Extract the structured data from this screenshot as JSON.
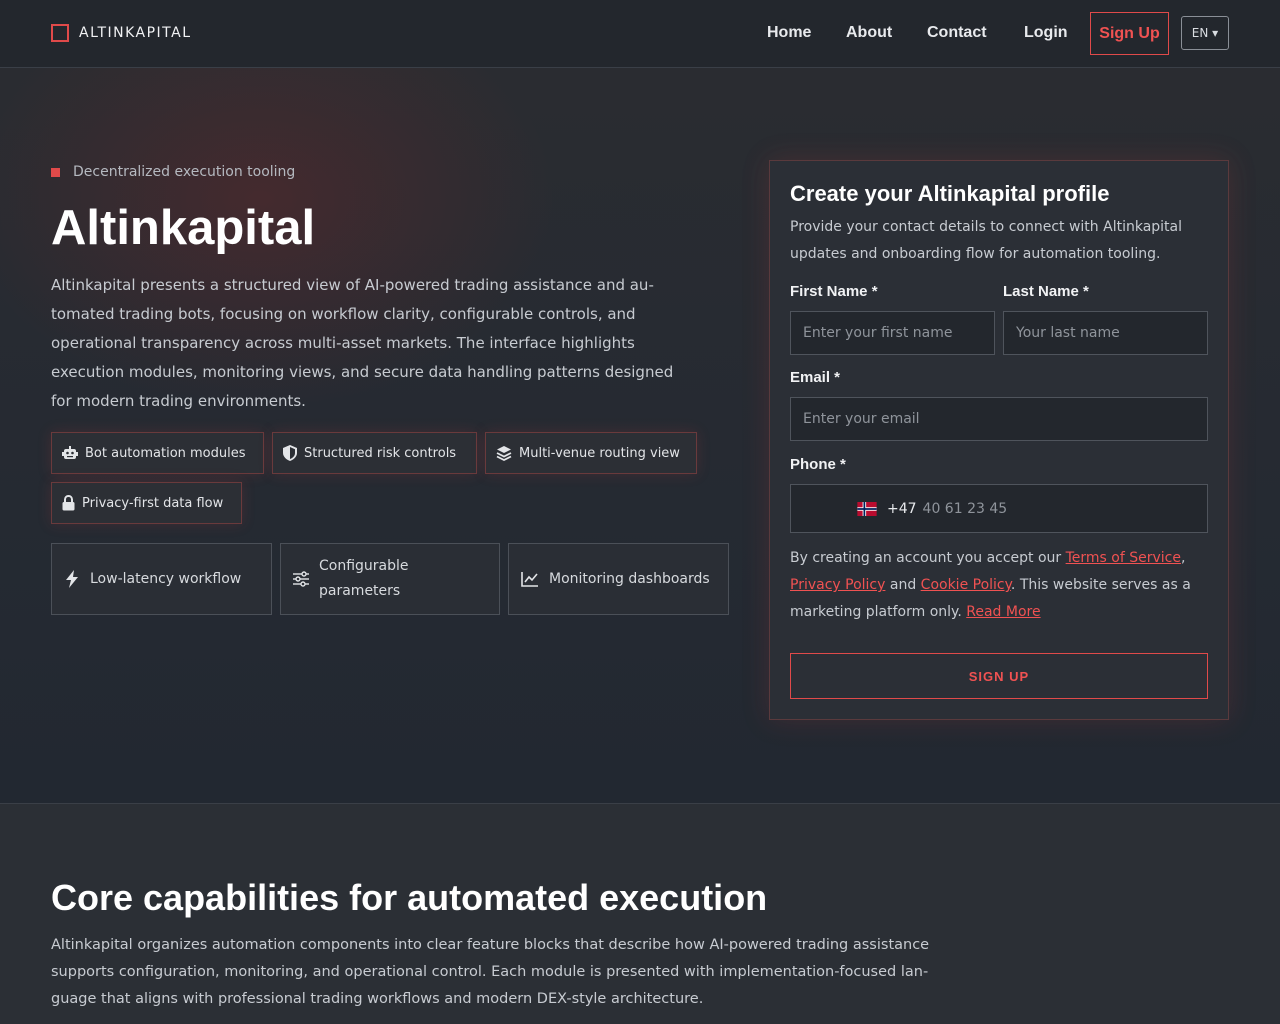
{
  "nav": {
    "brand": "ALTINKAPITAL",
    "links": [
      "Home",
      "About",
      "Contact",
      "Login"
    ],
    "signup": "Sign Up",
    "language": "EN ▾"
  },
  "hero": {
    "eyebrow": "Decentralized execution tooling",
    "title": "Altinkapital",
    "description": "Altinkapital presents a structured view of AI-powered trading assistance and au­tomated trading bots, focusing on workflow clarity, configurable controls, and operational transparency across multi-asset markets. The interface highlights execution modules, monitoring views, and secure data handling patterns de­signed for modern trading environments.",
    "chips": [
      {
        "label": "Bot automation modules",
        "icon": "robot-icon"
      },
      {
        "label": "Structured risk controls",
        "icon": "shield-icon"
      },
      {
        "label": "Multi-venue routing view",
        "icon": "layers-icon"
      },
      {
        "label": "Privacy-first data flow",
        "icon": "lock-icon"
      }
    ],
    "features": [
      {
        "label": "Low-latency workflow",
        "icon": "bolt-icon"
      },
      {
        "label": "Configurable parameters",
        "icon": "sliders-icon"
      },
      {
        "label": "Monitoring dashboards",
        "icon": "chart-line-icon"
      }
    ]
  },
  "form": {
    "title": "Create your Altinkapital profile",
    "subtitle": "Provide your contact details to connect with Altinkapital updates and onboarding flow for automation tooling.",
    "first_name_label": "First Name *",
    "first_name_placeholder": "Enter your first name",
    "last_name_label": "Last Name *",
    "last_name_placeholder": "Your last name",
    "email_label": "Email *",
    "email_placeholder": "Enter your email",
    "phone_label": "Phone *",
    "phone_dial": "+47",
    "phone_placeholder": "40 61 23 45",
    "terms_prefix": "By creating an account you accept our ",
    "terms_link": "Terms of Service",
    "terms_sep": ",",
    "privacy_link": "Privacy Policy",
    "terms_and": " and ",
    "cookie_link": "Cookie Policy",
    "terms_suffix": ". This website serves as a marketing platform only. ",
    "read_more": "Read More",
    "submit": "SIGN UP"
  },
  "section": {
    "title": "Core capabilities for automated execution",
    "description": "Altinkapital organizes automation components into clear feature blocks that describe how AI-powered trading assistance supports configuration, monitoring, and operational control. Each module is presented with implementation-focused lan­guage that aligns with professional trading workflows and modern DEX-style architecture."
  },
  "colors": {
    "accent": "#e04a4a",
    "background": "#2b2f35",
    "nav": "#23272d"
  }
}
